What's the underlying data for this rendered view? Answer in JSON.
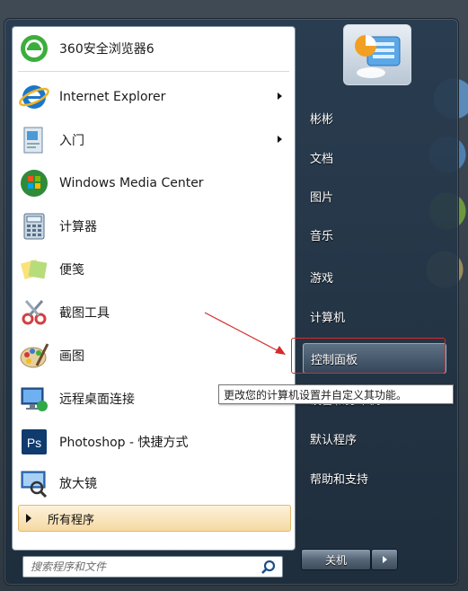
{
  "programs": [
    {
      "label": "360安全浏览器6",
      "icon": "360-browser-icon",
      "has_submenu": false
    },
    {
      "label": "Internet Explorer",
      "icon": "internet-explorer-icon",
      "has_submenu": true
    },
    {
      "label": "入门",
      "icon": "getting-started-icon",
      "has_submenu": true
    },
    {
      "label": "Windows Media Center",
      "icon": "windows-media-center-icon",
      "has_submenu": false
    },
    {
      "label": "计算器",
      "icon": "calculator-icon",
      "has_submenu": false
    },
    {
      "label": "便笺",
      "icon": "sticky-notes-icon",
      "has_submenu": false
    },
    {
      "label": "截图工具",
      "icon": "snipping-tool-icon",
      "has_submenu": false
    },
    {
      "label": "画图",
      "icon": "paint-icon",
      "has_submenu": false
    },
    {
      "label": "远程桌面连接",
      "icon": "remote-desktop-icon",
      "has_submenu": false
    },
    {
      "label": "Photoshop - 快捷方式",
      "icon": "photoshop-icon",
      "has_submenu": false
    },
    {
      "label": "放大镜",
      "icon": "magnifier-icon",
      "has_submenu": false
    }
  ],
  "all_programs": "所有程序",
  "search": {
    "placeholder": "搜索程序和文件"
  },
  "places": [
    {
      "label": "彬彬",
      "highlighted": false
    },
    {
      "label": "文档",
      "highlighted": false
    },
    {
      "label": "图片",
      "highlighted": false
    },
    {
      "label": "音乐",
      "highlighted": false
    },
    {
      "label": "游戏",
      "highlighted": false
    },
    {
      "label": "计算机",
      "highlighted": false
    },
    {
      "label": "控制面板",
      "highlighted": true
    },
    {
      "label": "设备和打印机",
      "highlighted": false
    },
    {
      "label": "默认程序",
      "highlighted": false
    },
    {
      "label": "帮助和支持",
      "highlighted": false
    }
  ],
  "tooltip": "更改您的计算机设置并自定义其功能。",
  "shutdown": {
    "label": "关机"
  },
  "colors": {
    "annotation_red": "#d62a2a",
    "all_programs_bg": "#f6d9a2"
  }
}
